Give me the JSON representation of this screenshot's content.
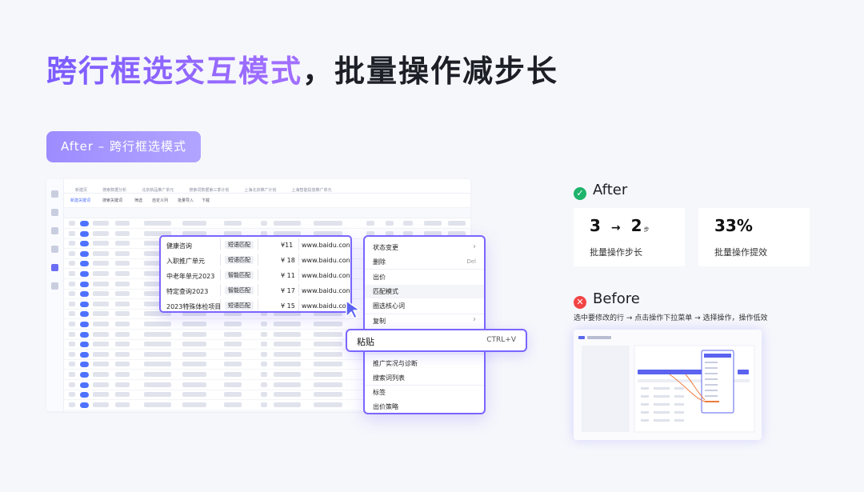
{
  "title": {
    "highlight": "跨行框选交互模式",
    "rest": "，批量操作减步长"
  },
  "tag": "After – 跨行框选模式",
  "screenshot": {
    "tabs": [
      "新建页",
      "搜索数据分析",
      "北京新品推广单元",
      "搜索词数据第三季计划",
      "上海北京推广计划",
      "上海智能投放推广单元"
    ],
    "toolbar": [
      "新建关键词",
      "搜索关键词",
      "筛选",
      "自定义列",
      "批量导入",
      "下载"
    ],
    "selection_rows": [
      {
        "name": "健康咨询",
        "match": "短语匹配",
        "price": "¥11",
        "url": "www.baidu.con"
      },
      {
        "name": "入职推广单元",
        "match": "短语匹配",
        "price": "¥ 18",
        "url": "www.baidu.con"
      },
      {
        "name": "中老年单元2023",
        "match": "智能匹配",
        "price": "¥ 11",
        "url": "www.baidu.con"
      },
      {
        "name": "特定查询2023",
        "match": "智能匹配",
        "price": "¥ 17",
        "url": "www.baidu.con"
      },
      {
        "name": "2023特殊体检项目",
        "match": "短语匹配",
        "price": "¥ 15",
        "url": "www.baidu.con"
      }
    ],
    "context_menu": {
      "items": [
        "状态变更",
        "删除",
        "出价",
        "匹配模式",
        "圈选核心词",
        "复制",
        "推广实况与诊断",
        "搜索词列表",
        "标签",
        "出价策略"
      ],
      "delete_shortcut": "Del",
      "submenu_arrow": "›"
    },
    "paste": {
      "label": "粘贴",
      "shortcut": "CTRL+V"
    }
  },
  "after": {
    "heading": "After",
    "steps_from": "3",
    "steps_arrow": "→",
    "steps_to": "2",
    "steps_unit": "步",
    "steps_label": "批量操作步长",
    "efficiency_value": "33%",
    "efficiency_label": "批量操作提效"
  },
  "before": {
    "heading": "Before",
    "description": "选中要修改的行 → 点击操作下拉菜单 → 选择操作，操作低效"
  },
  "colors": {
    "accent": "#7a66ff",
    "ok": "#1fb36c",
    "error": "#f24444",
    "toggle": "#4e72ff"
  },
  "icons": {
    "after": "check-circle-icon",
    "before": "close-circle-icon"
  }
}
